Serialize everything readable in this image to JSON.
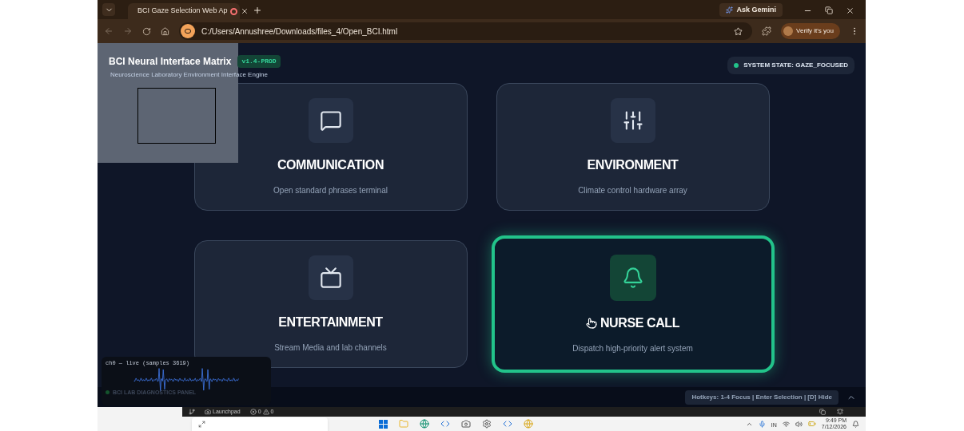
{
  "browser": {
    "tab_title": "BCI Gaze Selection Web Ap",
    "address": "C:/Users/Annushree/Downloads/files_4/Open_BCI.html",
    "ask_button": "Ask Gemini",
    "profile_button": "Verify it's you"
  },
  "header": {
    "title": "BCI Neural Interface Matrix",
    "version": "v1.4-PROD",
    "subtitle": "Neuroscience Laboratory Environment Interface Engine",
    "status": "SYSTEM STATE: GAZE_FOCUSED"
  },
  "cards": [
    {
      "title": "COMMUNICATION",
      "description": "Open standard phrases terminal",
      "selected": false
    },
    {
      "title": "ENVIRONMENT",
      "description": "Climate control hardware array",
      "selected": false
    },
    {
      "title": "ENTERTAINMENT",
      "description": "Stream Media and lab channels",
      "selected": false
    },
    {
      "title": "NURSE CALL",
      "description": "Dispatch high-priority alert system",
      "selected": true
    }
  ],
  "diagnostics": {
    "stream": "ch0 — live (samples 3619)",
    "title": "BCI LAB DIAGNOSTICS PANEL"
  },
  "footer": {
    "hotkeys": "Hotkeys: 1-4 Focus | Enter Selection | [D] Hide"
  },
  "editor_status": {
    "launchpad": "Launchpad",
    "errors": "0",
    "warnings": "0"
  },
  "taskbar": {
    "language": "IN",
    "time": "9:49 PM",
    "date": "7/12/2026"
  }
}
